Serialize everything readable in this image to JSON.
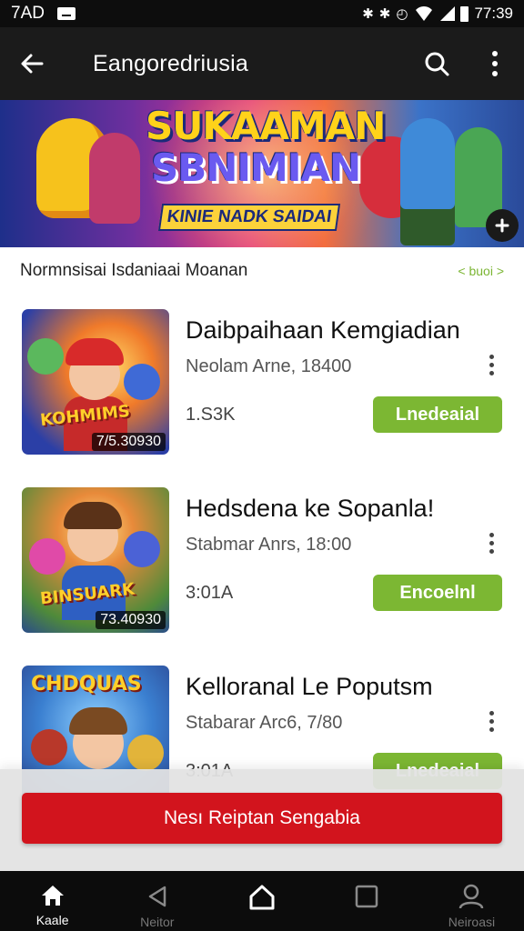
{
  "status_bar": {
    "carrier": "7AD",
    "time": "77:39"
  },
  "header": {
    "title": "Eangoredriusia"
  },
  "banner": {
    "title_line1": "SUKAAMAN",
    "title_line2": "SBNIMIAN",
    "subtitle": "KINIE NADK SAIDAI"
  },
  "section": {
    "title": "Normnsisai Isdaniaai Moanan",
    "link": "< buoi >"
  },
  "items": [
    {
      "name": "Daibpaihaan Kemgiadian",
      "meta": "Neolam Arne, 18400",
      "count": "1.S3K",
      "button": "Lnedeaial",
      "badge": "7/5.30930",
      "logo": "KOHMIMS"
    },
    {
      "name": "Hedsdena ke Sopanla!",
      "meta": "Stabmar Anrs, 18:00",
      "count": "3:01A",
      "button": "Encoelnl",
      "badge": "73.40930",
      "logo": "BINSUARK"
    },
    {
      "name": "Kelloranal Le Poputsm",
      "meta": "Stabarar Arc6, 7/80",
      "count": "3:01A",
      "button": "Lnedeaial",
      "badge": "",
      "logo": "CHDQUAS"
    }
  ],
  "cta": {
    "label": "Nesı Reiptan Sengabia"
  },
  "nav": [
    {
      "label": "Kaale",
      "icon": "home-icon"
    },
    {
      "label": "Neitor",
      "icon": "back-triangle-icon"
    },
    {
      "label": "",
      "icon": "house-outline-icon"
    },
    {
      "label": "",
      "icon": "square-icon"
    },
    {
      "label": "Neiroasi",
      "icon": "person-icon"
    }
  ],
  "colors": {
    "accent_green": "#7cb733",
    "cta_red": "#d2141d",
    "app_bar": "#1b1b1b"
  }
}
